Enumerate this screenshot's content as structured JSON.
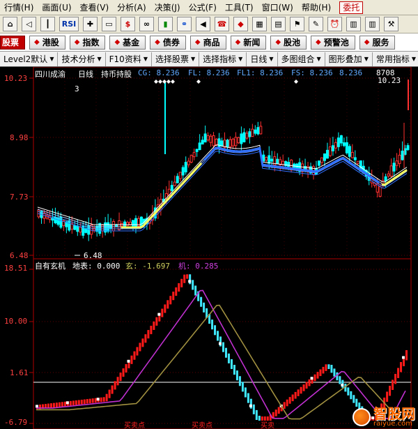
{
  "menu": {
    "items": [
      "行情(H)",
      "画面(U)",
      "查看(V)",
      "分析(A)",
      "决策(J)",
      "公式(F)",
      "工具(T)",
      "窗口(W)",
      "帮助(H)"
    ],
    "trust": "委托"
  },
  "toolbar": {
    "icons": [
      "home-icon",
      "back-icon",
      "kline-icon",
      "rsi-icon",
      "crosshair-icon",
      "ruler-icon",
      "dollar-icon",
      "glasses-icon",
      "chart-bars-icon",
      "binoculars-icon",
      "megaphone-icon",
      "phone-icon",
      "diamond-icon",
      "map-icon",
      "calendar-icon",
      "flag-icon",
      "paint-icon",
      "alarm-icon",
      "book-icon",
      "books-icon",
      "tools-icon"
    ],
    "rsi_label": "RSI"
  },
  "quickbar": {
    "items": [
      "股票",
      "港股",
      "指数",
      "基金",
      "债券",
      "商品",
      "新闻",
      "股池",
      "预警池",
      "服务"
    ]
  },
  "tabs": {
    "items": [
      "Level2默认",
      "技术分析",
      "F10资料",
      "选择股票",
      "选择指标",
      "日线",
      "多图组合",
      "图形叠加",
      "常用指标"
    ]
  },
  "main_chart": {
    "title": "四川成渝",
    "period": "日线",
    "indicator_name": "持币持股",
    "cg_label": "CG:",
    "cg_value": "8.236",
    "fl_label": "FL:",
    "fl_value": "8.236",
    "fl1_label": "FL1:",
    "fl1_value": "8.236",
    "fs_label": "FS:",
    "fs_value": "8.236",
    "extra_value": "8.236",
    "extra_tail": "8708",
    "high_label": "10.23",
    "low_label": "6.48",
    "marker_3": "3",
    "y_ticks": [
      "10.23",
      "8.98",
      "7.73",
      "6.48"
    ],
    "colors": {
      "up": "#ff3030",
      "down": "#00ffff",
      "ma": "#ffff60",
      "ma_blue": "#3070ff"
    }
  },
  "sub_chart": {
    "title": "自有玄机",
    "ground_label": "地表:",
    "ground_value": "0.000",
    "xuan_label": "玄:",
    "xuan_value": "-1.697",
    "ji_label": "机:",
    "ji_value": "0.285",
    "y_ticks": [
      "18.51",
      "10.00",
      "1.61",
      "-6.79"
    ],
    "bottom_labels": [
      "买卖点",
      "买卖点",
      "买卖"
    ],
    "colors": {
      "up": "#ff1a1a",
      "down": "#40e8ff",
      "purple": "#c030d0",
      "olive": "#a09040",
      "line": "#ffffff"
    }
  },
  "watermark": {
    "cn": "智股网",
    "en": "raiyue.com"
  }
}
